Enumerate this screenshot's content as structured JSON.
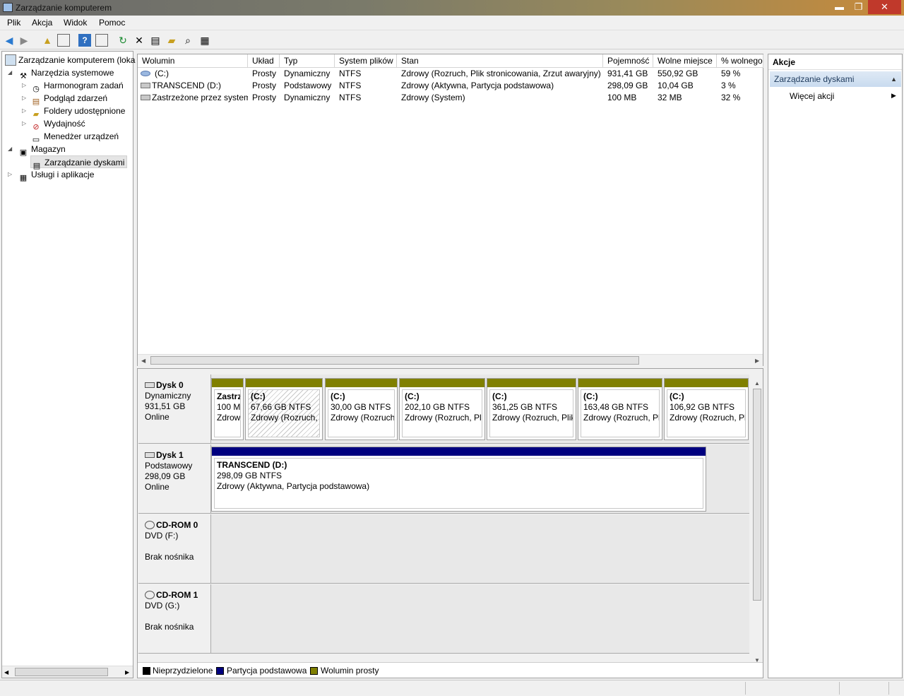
{
  "window": {
    "title": "Zarządzanie komputerem",
    "min_glyph": "▬",
    "max_glyph": "❐",
    "close_glyph": "✕"
  },
  "menu": [
    "Plik",
    "Akcja",
    "Widok",
    "Pomoc"
  ],
  "toolbar": [
    "back-icon",
    "forward-icon",
    "up-folder-icon",
    "show-hide-tree-icon",
    "help-icon",
    "show-hide-action-icon",
    "refresh-icon",
    "delete-icon",
    "properties-icon",
    "open-icon",
    "search-icon",
    "settings-icon"
  ],
  "tree": {
    "root": "Zarządzanie komputerem (loka",
    "system_tools": "Narzędzia systemowe",
    "task_scheduler": "Harmonogram zadań",
    "event_viewer": "Podgląd zdarzeń",
    "shared_folders": "Foldery udostępnione",
    "performance": "Wydajność",
    "device_manager": "Menedżer urządzeń",
    "storage": "Magazyn",
    "disk_management": "Zarządzanie dyskami",
    "services": "Usługi i aplikacje"
  },
  "volumes": {
    "columns": [
      "Wolumin",
      "Układ",
      "Typ",
      "System plików",
      "Stan",
      "Pojemność",
      "Wolne miejsce",
      "% wolnego"
    ],
    "rows": [
      [
        "(C:)",
        "Prosty",
        "Dynamiczny",
        "NTFS",
        "Zdrowy (Rozruch, Plik stronicowania, Zrzut awaryjny)",
        "931,41 GB",
        "550,92 GB",
        "59 %"
      ],
      [
        "TRANSCEND (D:)",
        "Prosty",
        "Podstawowy",
        "NTFS",
        "Zdrowy (Aktywna, Partycja podstawowa)",
        "298,09 GB",
        "10,04 GB",
        "3 %"
      ],
      [
        "Zastrzeżone przez system",
        "Prosty",
        "Dynamiczny",
        "NTFS",
        "Zdrowy (System)",
        "100 MB",
        "32 MB",
        "32 %"
      ]
    ]
  },
  "disks": {
    "disk0": {
      "name": "Dysk 0",
      "type": "Dynamiczny",
      "size": "931,51 GB",
      "status": "Online",
      "parts": [
        {
          "l1": "Zastrz",
          "l2": "100 M",
          "l3": "Zdrow"
        },
        {
          "l1": "(C:)",
          "l2": "67,66 GB NTFS",
          "l3": "Zdrowy (Rozruch, P"
        },
        {
          "l1": "(C:)",
          "l2": "30,00 GB NTFS",
          "l3": "Zdrowy (Rozruch"
        },
        {
          "l1": "(C:)",
          "l2": "202,10 GB NTFS",
          "l3": "Zdrowy (Rozruch, Pli"
        },
        {
          "l1": "(C:)",
          "l2": "361,25 GB NTFS",
          "l3": "Zdrowy (Rozruch, Plik"
        },
        {
          "l1": "(C:)",
          "l2": "163,48 GB NTFS",
          "l3": "Zdrowy (Rozruch, Pl"
        },
        {
          "l1": "(C:)",
          "l2": "106,92 GB NTFS",
          "l3": "Zdrowy (Rozruch, Pl"
        }
      ]
    },
    "disk1": {
      "name": "Dysk 1",
      "type": "Podstawowy",
      "size": "298,09 GB",
      "status": "Online",
      "part": {
        "l1": "TRANSCEND  (D:)",
        "l2": "298,09 GB NTFS",
        "l3": "Zdrowy (Aktywna, Partycja podstawowa)"
      }
    },
    "cdrom0": {
      "name": "CD-ROM 0",
      "type": "DVD (F:)",
      "status": "Brak nośnika"
    },
    "cdrom1": {
      "name": "CD-ROM 1",
      "type": "DVD (G:)",
      "status": "Brak nośnika"
    }
  },
  "legend": {
    "unallocated": "Nieprzydzielone",
    "primary": "Partycja podstawowa",
    "simple": "Wolumin prosty"
  },
  "colors": {
    "simple": "#808000",
    "primary": "#00007f",
    "unallocated": "#000000"
  },
  "actions": {
    "title": "Akcje",
    "section": "Zarządzanie dyskami",
    "more": "Więcej akcji"
  }
}
